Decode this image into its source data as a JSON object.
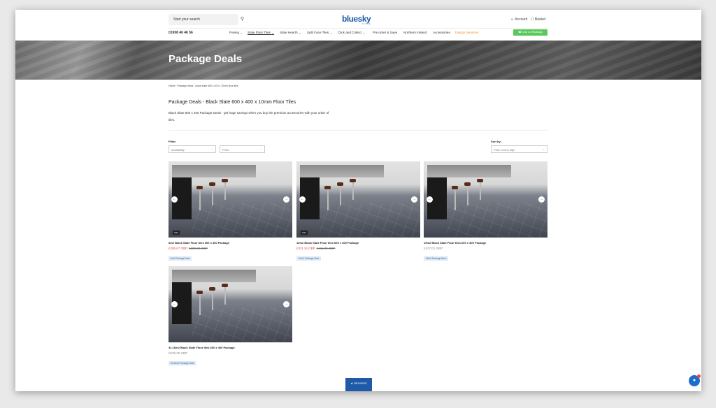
{
  "header": {
    "search_placeholder": "Start your search",
    "logo_text": "bluesky",
    "logo_sub": "STONE",
    "account_label": "Account",
    "basket_label": "Basket",
    "phone": "01908 46 46 56",
    "nav": [
      "Paving",
      "Slate Floor Tiles",
      "Slate Hearth",
      "Split Face Tiles",
      "Click and Collect",
      "Pre order & Save",
      "Northern Ireland",
      "Accessories",
      "Design Services"
    ],
    "whatsapp_label": "Chat on WhatsApp"
  },
  "hero": {
    "title": "Package Deals"
  },
  "breadcrumb": "Home › Package deals - black slate 600 x 400 x 10mm floor tiles",
  "page_title": "Package Deals - Black Slate 600 x 400 x 10mm Floor Tiles",
  "description": "Black Slate 600 x 400 Package Deals - get huge savings when you buy the premium accessories with your order of tiles.",
  "filter": {
    "label": "Filter:",
    "availability": "Availability",
    "price": "Price"
  },
  "sort": {
    "label": "Sort by:",
    "value": "Price, low to high"
  },
  "products": [
    {
      "name": "5m2 Black Slate Floor tiles 600 x 400 Package",
      "price": "£205.67 GBP",
      "was": "£300.00 GBP",
      "tag": "5m2 Package Deal",
      "sale": "Sale"
    },
    {
      "name": "10m2 Black Slate Floor tiles 600 x 400 Package",
      "price": "£311.34 GBP",
      "was": "£411.00 GBP",
      "tag": "10m2 Package Deal",
      "sale": "Sale"
    },
    {
      "name": "15m2 Black Slate Floor tiles 600 x 400 Package",
      "price": "£417.01 GBP",
      "was": "",
      "tag": "15m2 Package Deal",
      "sale": ""
    },
    {
      "name": "32.16m2 Black Slate Floor tiles 600 x 400 Package",
      "price": "£575.25 GBP",
      "was": "",
      "tag": "32.16m2 Package Deal",
      "sale": ""
    }
  ],
  "reviews_label": "★ REVIEWS"
}
